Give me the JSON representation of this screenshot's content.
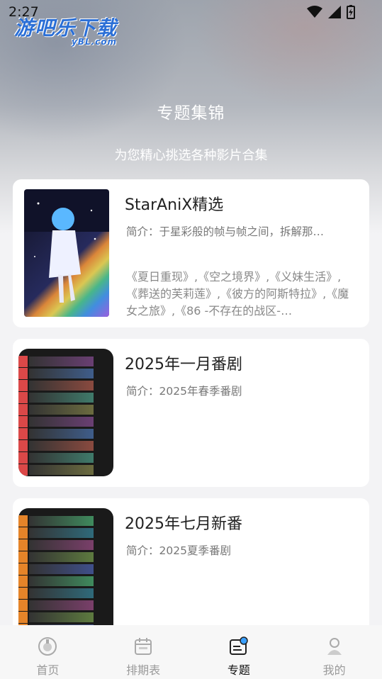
{
  "status_bar": {
    "time": "2:27"
  },
  "watermark": {
    "brand": "游吧乐下载",
    "domain": "yBL.com"
  },
  "header": {
    "title": "专题集锦",
    "subtitle": "为您精心挑选各种影片合集"
  },
  "cards": [
    {
      "title": "StarAniX精选",
      "desc": "简介：于星彩般的帧与帧之间，拆解那…",
      "tags": "《夏日重现》,《空之境界》,《义妹生活》,《葬送的芙莉莲》,《彼方的阿斯特拉》,《魔女之旅》,《86 -不存在的战区-…"
    },
    {
      "title": "2025年一月番剧",
      "desc": "简介：2025年春季番剧",
      "tags": ""
    },
    {
      "title": "2025年七月新番",
      "desc": "简介：2025夏季番剧",
      "tags": ""
    }
  ],
  "tabbar": {
    "items": [
      {
        "label": "首页",
        "icon": "home-icon",
        "active": false
      },
      {
        "label": "排期表",
        "icon": "calendar-icon",
        "active": false
      },
      {
        "label": "专题",
        "icon": "topic-icon",
        "active": true
      },
      {
        "label": "我的",
        "icon": "profile-icon",
        "active": false
      }
    ]
  },
  "colors": {
    "accent": "#111111",
    "inactive": "#9a9a9a",
    "watermark": "#2b6fd6"
  }
}
